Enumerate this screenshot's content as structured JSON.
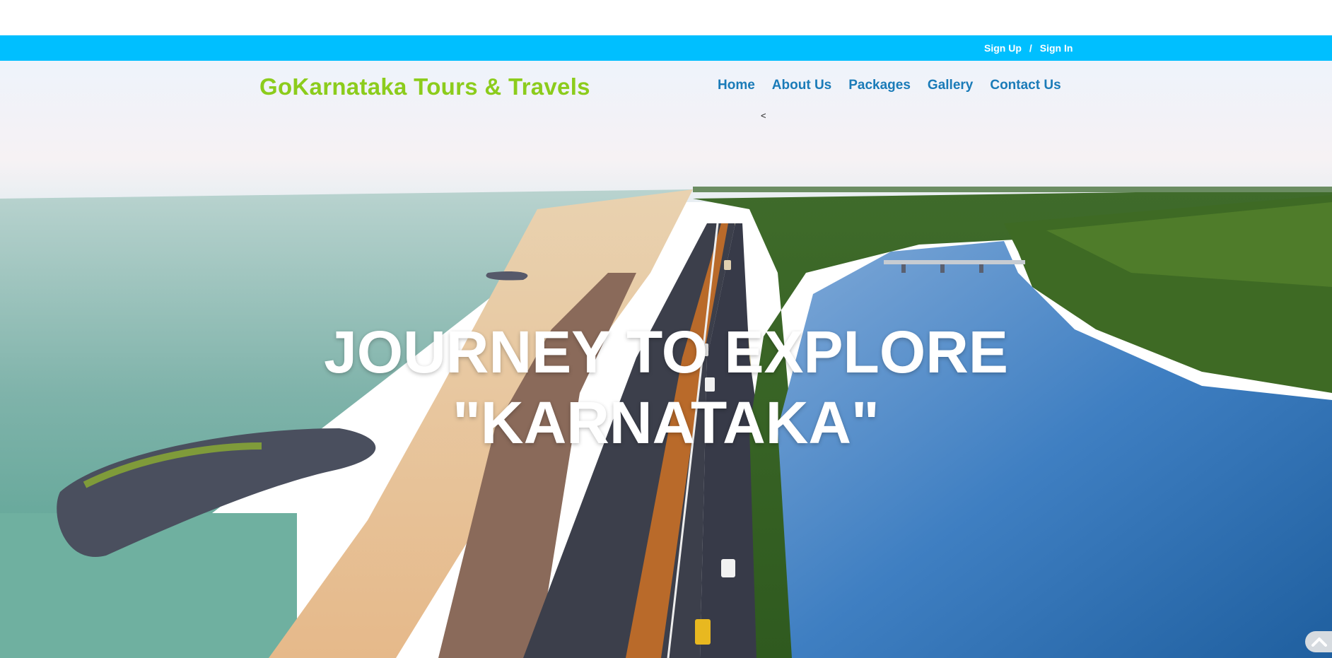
{
  "auth": {
    "sign_up": "Sign Up",
    "separator": "/",
    "sign_in": "Sign In"
  },
  "header": {
    "brand": "GoKarnataka Tours & Travels",
    "nav": [
      "Home",
      "About Us",
      "Packages",
      "Gallery",
      "Contact Us"
    ],
    "carousel_prev_glyph": "<"
  },
  "hero": {
    "headline_line1": "JOURNEY TO EXPLORE",
    "headline_line2": "\"KARNATAKA\""
  },
  "icons": {
    "scroll_top": "chevron-up-icon"
  },
  "colors": {
    "auth_bar": "#00bfff",
    "brand": "#8ccc1c",
    "nav_link": "#1a7bb8"
  }
}
